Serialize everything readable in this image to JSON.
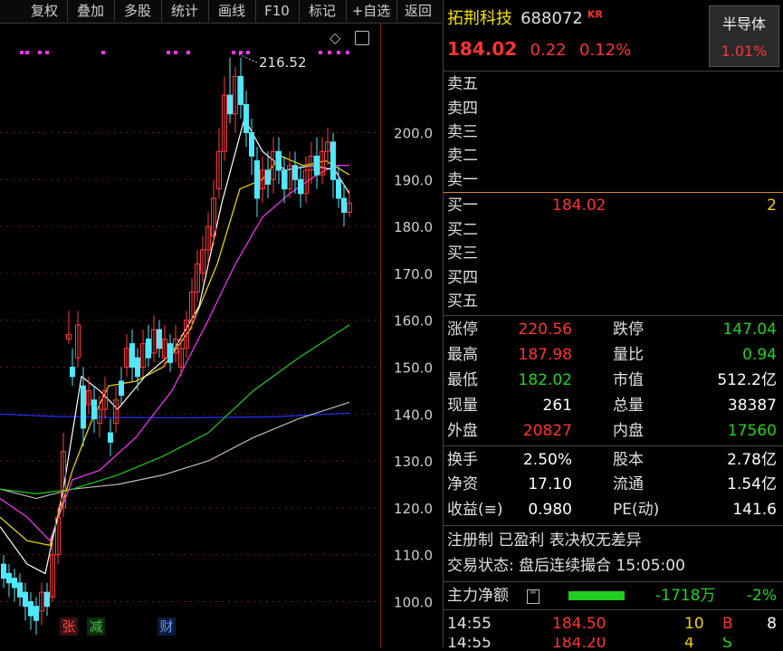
{
  "toolbar": {
    "items": [
      "复权",
      "叠加",
      "多股",
      "统计",
      "画线",
      "F10",
      "标记",
      "+自选",
      "返回"
    ]
  },
  "chart": {
    "y_ticks": [
      "200.0",
      "190.0",
      "180.0",
      "170.0",
      "160.0",
      "150.0",
      "140.0",
      "130.0",
      "120.0",
      "110.0",
      "100.0"
    ],
    "high_label": "216.52",
    "markers": [
      "张",
      "减",
      "财"
    ],
    "colors": {
      "up": "#ff3b3b",
      "down": "#4ee8ff",
      "ma5": "#ffffff",
      "ma10": "#f2e200",
      "ma20": "#ff33ff",
      "ma60": "#22cc22",
      "ma120": "#bbbbbb",
      "ma250": "#2233ff"
    }
  },
  "stock": {
    "name": "拓荆科技",
    "code": "688072",
    "tag": "KR",
    "price": "184.02",
    "change": "0.22",
    "pct": "0.12%",
    "sector": "半导体",
    "sector_pct": "1.01%"
  },
  "orderbook": {
    "sell": [
      "卖五",
      "卖四",
      "卖三",
      "卖二",
      "卖一"
    ],
    "buy": [
      {
        "label": "买一",
        "price": "184.02",
        "vol": "2"
      },
      {
        "label": "买二"
      },
      {
        "label": "买三"
      },
      {
        "label": "买四"
      },
      {
        "label": "买五"
      }
    ]
  },
  "stats": [
    {
      "l1": "涨停",
      "v1": "220.56",
      "l2": "跌停",
      "v2": "147.04"
    },
    {
      "l1": "最高",
      "v1": "187.98",
      "l2": "量比",
      "v2": "0.94"
    },
    {
      "l1": "最低",
      "v1": "182.02",
      "l2": "市值",
      "v2": "512.2亿"
    },
    {
      "l1": "现量",
      "v1": "261",
      "l2": "总量",
      "v2": "38387"
    },
    {
      "l1": "外盘",
      "v1": "20827",
      "l2": "内盘",
      "v2": "17560"
    }
  ],
  "stats2": [
    {
      "l1": "换手",
      "v1": "2.50%",
      "l2": "股本",
      "v2": "2.78亿"
    },
    {
      "l1": "净资",
      "v1": "17.10",
      "l2": "流通",
      "v2": "1.54亿"
    },
    {
      "l1": "收益(≡)",
      "v1": "0.980",
      "l2": "PE(动)",
      "v2": "141.6"
    }
  ],
  "info": {
    "tags": "注册制 已盈利 表决权无差异",
    "state": "交易状态: 盘后连续撮合 15:05:00"
  },
  "capital": {
    "label": "主力净额",
    "amount": "-1718万",
    "pct": "-2%"
  },
  "ticks": [
    {
      "time": "14:55",
      "price": "184.50",
      "vol": "10",
      "side": "B",
      "n": "8"
    }
  ]
}
